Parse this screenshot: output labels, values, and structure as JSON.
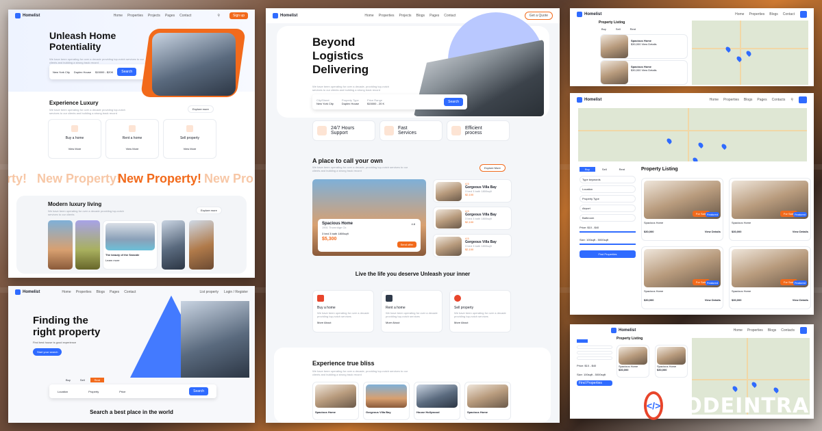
{
  "brand": {
    "name": "Homelist",
    "watermark": "CODEINTRA"
  },
  "nav": {
    "home": "Home",
    "properties": "Properties",
    "projects": "Projects",
    "blogs": "Blogs",
    "pages": "Pages",
    "contact": "Contact",
    "contacts": "Contacts",
    "signup": "Sign up",
    "get_quote": "Get a Quote",
    "list_property": "List property",
    "login": "Login / Register"
  },
  "p1": {
    "hero_title_1": "Unleash Home",
    "hero_title_2": "Potentiality",
    "hero_desc": "We have been operating for over a decade providing top-notch services to our clients and building a strong track record",
    "search": {
      "location": "New York City",
      "type": "Duplex House",
      "price": "$15000 - $20K",
      "btn": "Search"
    },
    "luxury_title": "Experience Luxury",
    "luxury_desc": "We have been operating for over a decade providing top-notch services to our clients and building a strong track record",
    "explore": "Explore more",
    "cards": [
      {
        "title": "Buy a home",
        "link": "View More"
      },
      {
        "title": "Rent a home",
        "link": "View More"
      },
      {
        "title": "Sell property",
        "link": "View More"
      }
    ],
    "marquee": [
      "rty!",
      "New Property!",
      "New Property!",
      "New Pro"
    ],
    "modern_title": "Modern luxury living",
    "modern_desc": "We have been operating for over a decade providing top-notch services to our clients",
    "feature_caption": "The beauty of the Seaside",
    "feature_link": "Learn more"
  },
  "p2": {
    "hero_title_1": "Finding the",
    "hero_title_2": "right property",
    "hero_desc": "Find best house is good experience",
    "hero_btn": "Start your search",
    "tabs": [
      "Buy",
      "Sell",
      "Rent"
    ],
    "fields": [
      {
        "label": "Location"
      },
      {
        "label": "Property"
      },
      {
        "label": "Price"
      }
    ],
    "search_btn": "Search",
    "section_title": "Search a best place in the world"
  },
  "p3": {
    "hero_title_1": "Beyond",
    "hero_title_2": "Logistics",
    "hero_title_3": "Delivering",
    "hero_desc": "We have been operating for over a decade, providing top-notch services to our clients and building a strong track record",
    "search": {
      "c1": "City/Street",
      "v1": "New York City",
      "c2": "Property Type",
      "v2": "Duplex House",
      "c3": "Price Range",
      "v3": "$15000 - 20 K",
      "btn": "Search"
    },
    "features": [
      {
        "title_1": "24/7 Hours",
        "title_2": "Support"
      },
      {
        "title_1": "Fast",
        "title_2": "Services"
      },
      {
        "title_1": "Efficient",
        "title_2": "process"
      }
    ],
    "place_title": "A place to call your own",
    "place_desc": "We have been operating for over a decade, providing top-notch services to our clients and building a strong track record",
    "place_btn": "Explore More",
    "spacious": {
      "title": "Spacious Home",
      "loc": "1901 Thornridge Cir.",
      "specs": "3 bed  3 bath  1800sqft",
      "price": "$5,300",
      "btn": "Send offer",
      "rating": "4.8"
    },
    "villas": [
      {
        "rating": "4.5",
        "title": "Gorgeous Villa Bay",
        "specs": "3 bed  3 bath  1800sqft",
        "price": "$2,100"
      },
      {
        "rating": "4.5",
        "title": "Gorgeous Villa Bay",
        "specs": "3 bed  3 bath  1800sqft",
        "price": "$2,100"
      },
      {
        "rating": "4.5",
        "title": "Gorgeous Villa Bay",
        "specs": "3 bed  3 bath  1800sqft",
        "price": "$2,100"
      }
    ],
    "live_title": "Live the life you deserve Unleash your inner",
    "services": [
      {
        "title": "Buy a home",
        "desc": "We have been operating for over a decade providing top-notch services",
        "link": "More About"
      },
      {
        "title": "Rent a home",
        "desc": "We have been operating for over a decade providing top-notch services",
        "link": "More About"
      },
      {
        "title": "Sell property",
        "desc": "We have been operating for over a decade providing top-notch services",
        "link": "More About"
      }
    ],
    "bliss_title": "Experience true bliss",
    "bliss_desc": "We have been operating for over a decade, providing top-notch services to our clients and building a strong track record",
    "bliss_cards": [
      "Spacious Home",
      "Gorgeous Villa Bay",
      "House Hollywood",
      "Spacious Home"
    ]
  },
  "p4": {
    "title": "Property Listing",
    "tabs": [
      "Buy",
      "Sell",
      "Rent"
    ],
    "items": [
      {
        "title": "Spacious Home",
        "price": "$30,000",
        "link": "View Details"
      },
      {
        "title": "Spacious Home",
        "price": "$30,000",
        "link": "View Details"
      }
    ]
  },
  "p5": {
    "tabs": [
      "Buy",
      "Sell",
      "Rent"
    ],
    "filters": [
      "Type keywords",
      "Location",
      "Property Type",
      "Airport",
      "Bathroom"
    ],
    "price_label": "Price: $10 - $40",
    "size_label": "Size: 100sqft - 5000sqft",
    "find_btn": "Find Properties",
    "title": "Property Listing",
    "listings": [
      {
        "title": "Spacious Home",
        "price": "$30,000",
        "link": "View Details",
        "tag1": "For Sale",
        "tag2": "Featured"
      },
      {
        "title": "Spacious Home",
        "price": "$30,000",
        "link": "View Details",
        "tag1": "For Sale",
        "tag2": "Featured"
      },
      {
        "title": "Spacious Home",
        "price": "$30,000",
        "link": "View Details",
        "tag1": "For Sale",
        "tag2": "Featured"
      },
      {
        "title": "Spacious Home",
        "price": "$30,000",
        "link": "View Details",
        "tag1": "For Sale",
        "tag2": "Featured"
      }
    ]
  },
  "p6": {
    "title": "Property Listing",
    "price_label": "Price: $10 - $40",
    "size_label": "Size: 100sqft - 5000sqft",
    "find_btn": "Find Properties",
    "items": [
      {
        "title": "Spacious Home",
        "price": "$30,000",
        "link": "View Details"
      },
      {
        "title": "Spacious Home",
        "price": "$30,000",
        "link": "View Details"
      }
    ]
  },
  "colors": {
    "accent": "#2f6bff",
    "orange": "#f26a1b"
  }
}
